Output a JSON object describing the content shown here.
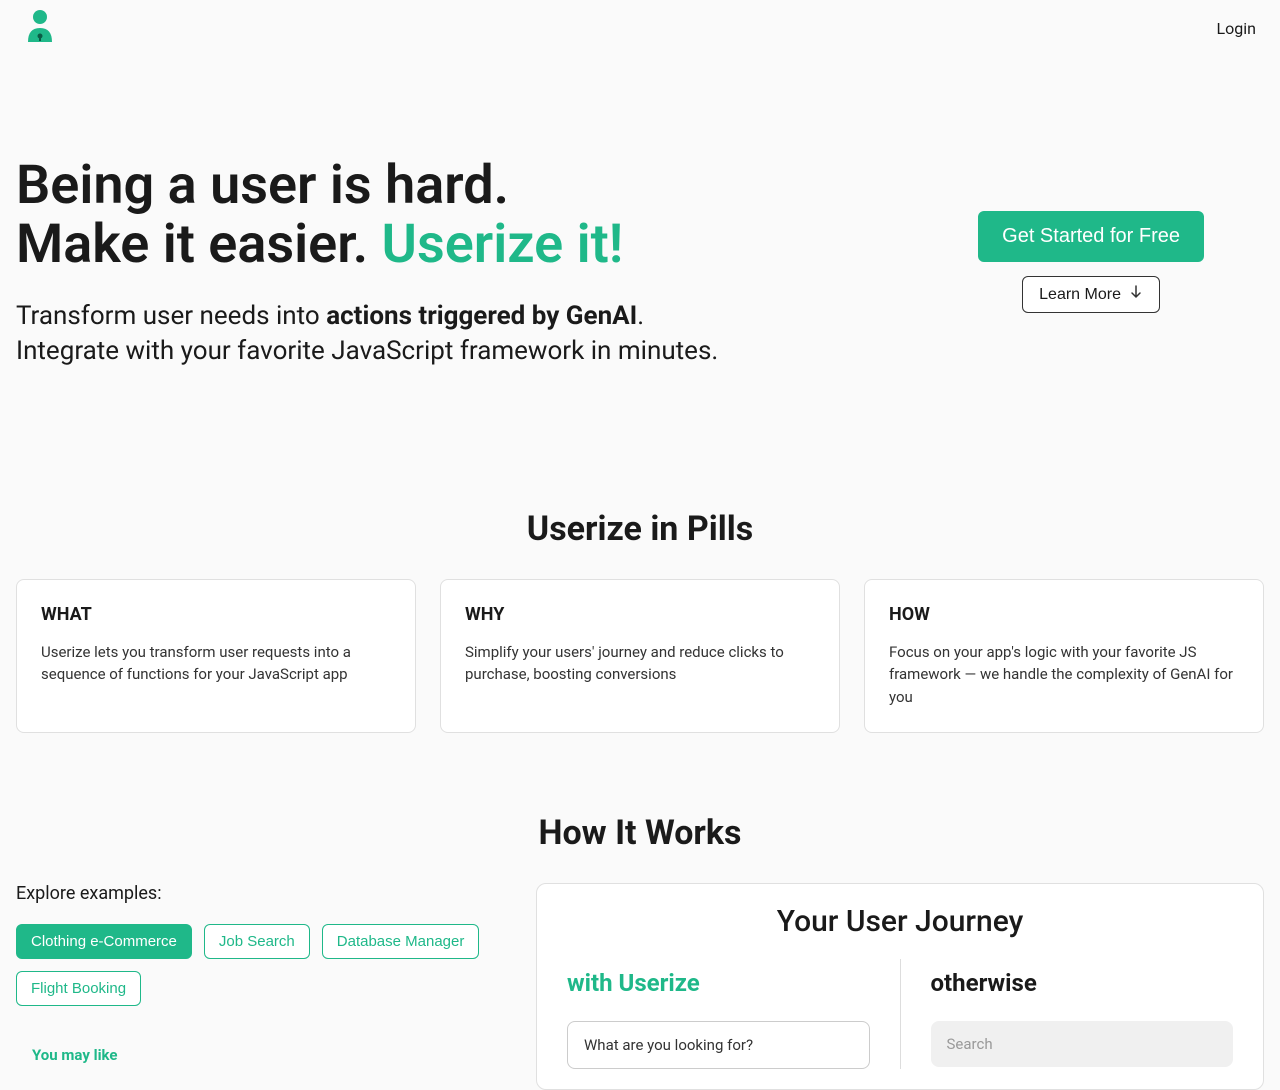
{
  "header": {
    "login": "Login"
  },
  "hero": {
    "line1": "Being a user is hard.",
    "line2a": "Make it easier. ",
    "line2b": "Userize it!",
    "sub1a": "Transform user needs into ",
    "sub1b": "actions triggered by GenAI",
    "sub1c": ".",
    "sub2": "Integrate with your favorite JavaScript framework in minutes.",
    "cta_primary": "Get Started for Free",
    "cta_secondary": "Learn More"
  },
  "pills": {
    "title": "Userize in Pills",
    "items": [
      {
        "heading": "WHAT",
        "body": "Userize lets you transform user requests into a sequence of functions for your JavaScript app"
      },
      {
        "heading": "WHY",
        "body": "Simplify your users' journey and reduce clicks to purchase, boosting conversions"
      },
      {
        "heading": "HOW",
        "body": "Focus on your app's logic with your favorite JS framework — we handle the complexity of GenAI for you"
      }
    ]
  },
  "howitworks": {
    "title": "How It Works",
    "explore_label": "Explore examples:",
    "tags": [
      {
        "label": "Clothing e-Commerce",
        "active": true
      },
      {
        "label": "Job Search",
        "active": false
      },
      {
        "label": "Database Manager",
        "active": false
      },
      {
        "label": "Flight Booking",
        "active": false
      }
    ],
    "you_may_like": "You may like",
    "journey": {
      "title": "Your User Journey",
      "with_label": "with Userize",
      "otherwise_label": "otherwise",
      "with_prompt": "What are you looking for?",
      "otherwise_placeholder": "Search"
    }
  }
}
